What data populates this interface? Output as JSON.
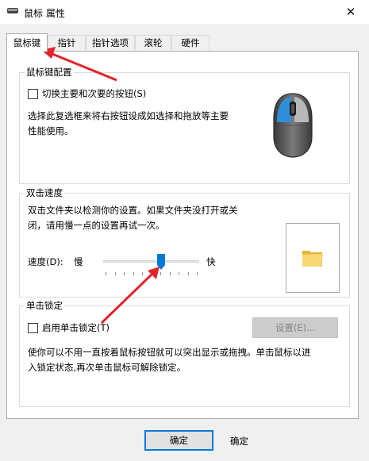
{
  "window": {
    "title": "鼠标 属性",
    "close_glyph": "✕"
  },
  "tabs": [
    {
      "label": "鼠标键",
      "active": true
    },
    {
      "label": "指针",
      "active": false
    },
    {
      "label": "指针选项",
      "active": false
    },
    {
      "label": "滚轮",
      "active": false
    },
    {
      "label": "硬件",
      "active": false
    }
  ],
  "buttons_group": {
    "title": "鼠标键配置",
    "checkbox_label": "切换主要和次要的按钮(S)",
    "checked": false,
    "description": [
      "选择此复选框来将右按钮设成如选择和拖放等主要",
      "性能使用。"
    ]
  },
  "dblclick_group": {
    "title": "双击速度",
    "description": [
      "双击文件夹以检测你的设置。如果文件夹没打开或关",
      "闭，请用慢一点的设置再试一次。"
    ],
    "speed_label": "速度(D):",
    "slow_label": "慢",
    "fast_label": "快",
    "speed_fraction": 0.6
  },
  "clicklock_group": {
    "title": "单击锁定",
    "checkbox_label": "启用单击锁定(T)",
    "checked": false,
    "settings_button": "设置(E)...",
    "description": [
      "使你可以不用一直按着鼠标按钮就可以突出显示或拖拽。单击鼠标以进",
      "入锁定状态,再次单击鼠标可解除锁定。"
    ]
  },
  "footer": {
    "ok_button": "确定",
    "ok_button_ghost": "确定"
  },
  "colors": {
    "accent": "#0078d7",
    "annotation_arrow": "#e0242b"
  },
  "icons": [
    "mouse-icon",
    "title-mouse-icon",
    "folder-icon",
    "close-icon"
  ]
}
